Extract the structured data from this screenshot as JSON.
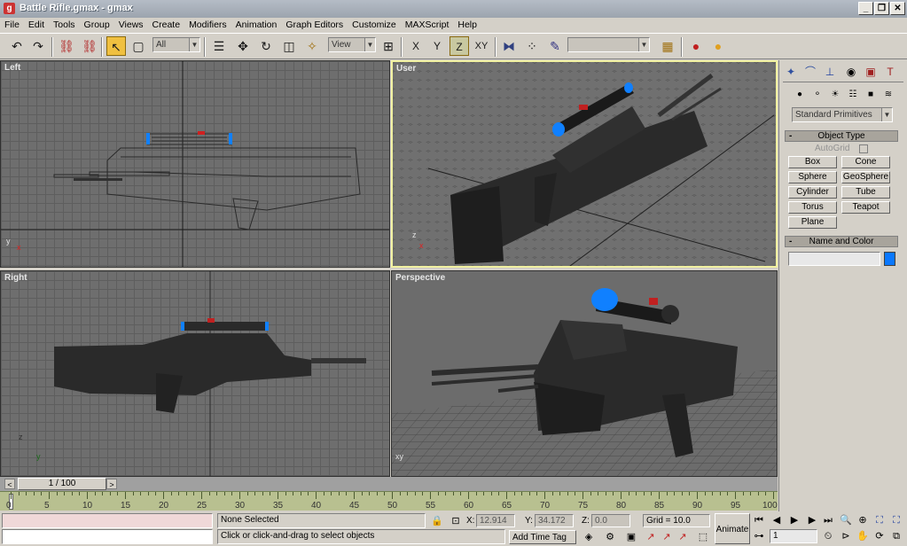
{
  "window": {
    "title": "Battle Rifle.gmax - gmax"
  },
  "menu": [
    "File",
    "Edit",
    "Tools",
    "Group",
    "Views",
    "Create",
    "Modifiers",
    "Animation",
    "Graph Editors",
    "Customize",
    "MAXScript",
    "Help"
  ],
  "toolbar": {
    "selection_filter": "All",
    "reference_coord": "View",
    "named_selection": ""
  },
  "viewports": {
    "left": "Left",
    "user": "User",
    "right": "Right",
    "perspective": "Perspective"
  },
  "command_panel": {
    "category_dropdown": "Standard Primitives",
    "object_type_title": "Object Type",
    "autogrid": "AutoGrid",
    "buttons": [
      "Box",
      "Cone",
      "Sphere",
      "GeoSphere",
      "Cylinder",
      "Tube",
      "Torus",
      "Teapot",
      "Plane"
    ],
    "name_color_title": "Name and Color",
    "object_color": "#0a78ff"
  },
  "time": {
    "slider": "1 / 100",
    "ticks": [
      "0",
      "5",
      "10",
      "15",
      "20",
      "25",
      "30",
      "35",
      "40",
      "45",
      "50",
      "55",
      "60",
      "65",
      "70",
      "75",
      "80",
      "85",
      "90",
      "95",
      "100"
    ]
  },
  "status": {
    "selection": "None Selected",
    "prompt": "Click or click-and-drag to select objects",
    "x": "12.914",
    "y": "34.172",
    "z": "0.0",
    "x_label": "X:",
    "y_label": "Y:",
    "z_label": "Z:",
    "grid": "Grid = 10.0",
    "add_time_tag": "Add Time Tag",
    "animate": "Animate",
    "frame": "1"
  }
}
